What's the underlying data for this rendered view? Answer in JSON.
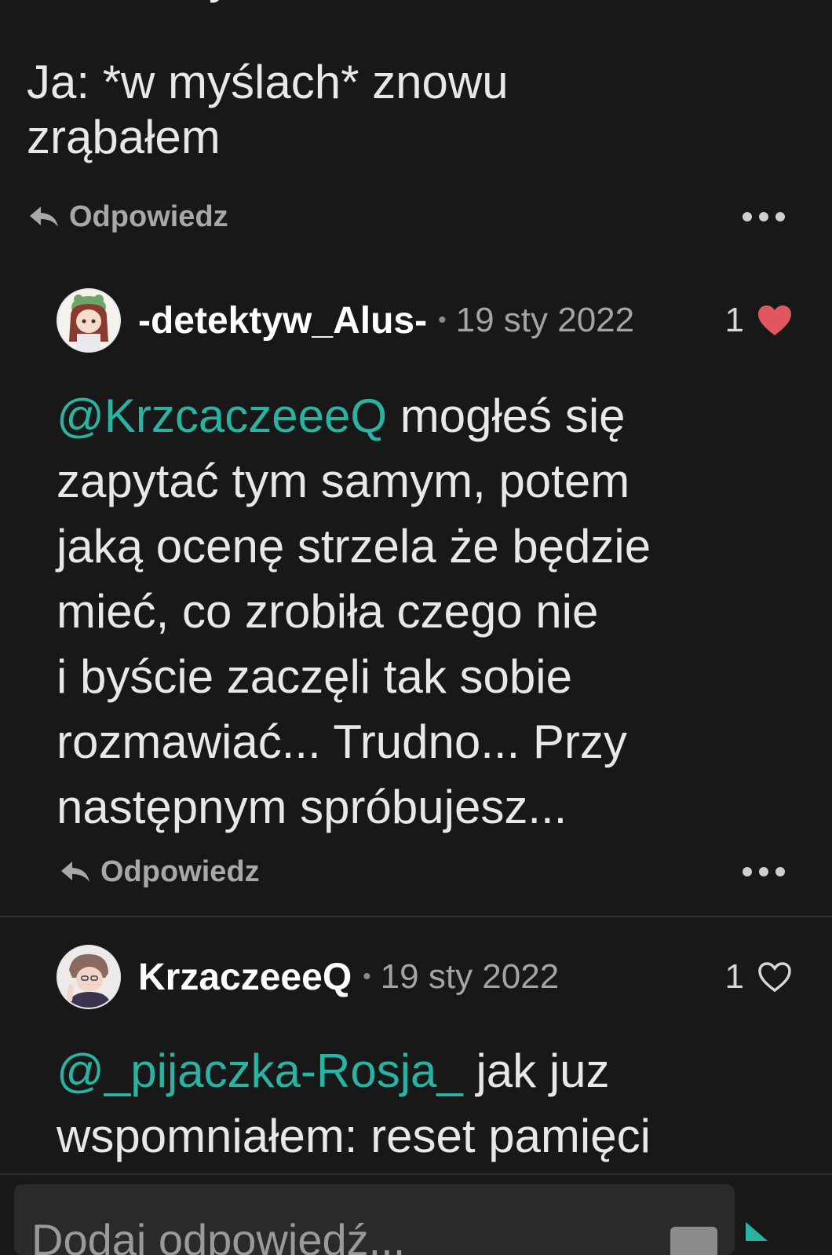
{
  "comment_prev": {
    "line1": "Ja: *w myślach* znowu",
    "line2": "zrąbałem",
    "reply_label": "Odpowiedz"
  },
  "comment_1": {
    "username": "-detektyw_Alus-",
    "separator": "•",
    "date": "19 sty 2022",
    "likes": "1",
    "liked": true,
    "mention": "@KrzcaczeeeQ",
    "body_lines": [
      " mogłeś się",
      "zapytać tym samym, potem",
      "jaką ocenę strzela że będzie",
      "mieć, co zrobiła czego nie",
      "i byście zaczęli tak sobie",
      "rozmawiać... Trudno... Przy",
      "następnym spróbujesz..."
    ],
    "reply_label": "Odpowiedz"
  },
  "comment_2": {
    "username": "KrzaczeeeQ",
    "separator": "•",
    "date": "19 sty 2022",
    "likes": "1",
    "liked": false,
    "mention": "@_pijaczka-Rosja_",
    "body_lines": [
      " jak juz",
      "wspomniałem: reset pamięci"
    ]
  },
  "composer": {
    "placeholder": "Dodaj odpowiedź..."
  },
  "colors": {
    "background": "#181818",
    "accent": "#2ab3a3",
    "heart_liked": "#e0575f"
  },
  "icons": [
    "reply-arrow-icon",
    "more-dots-icon",
    "heart-filled-icon",
    "heart-outline-icon",
    "send-icon"
  ]
}
